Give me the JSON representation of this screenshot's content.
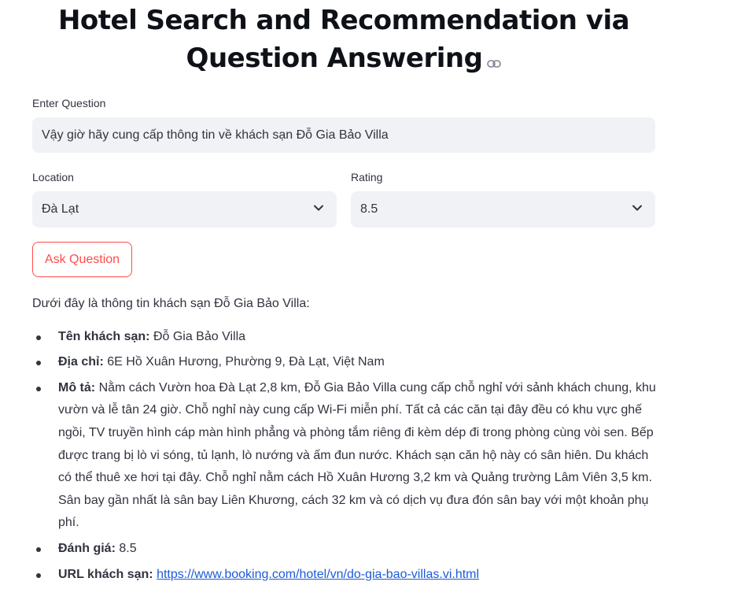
{
  "page": {
    "title_line1": "Hotel Search and Recommendation via",
    "title_line2": "Question Answering",
    "title_icon": "link-icon"
  },
  "question": {
    "label": "Enter Question",
    "value": "Vậy giờ hãy cung cấp thông tin về khách sạn Đỗ Gia Bảo Villa"
  },
  "location": {
    "label": "Location",
    "value": "Đà Lạt",
    "icon": "chevron-down-icon"
  },
  "rating": {
    "label": "Rating",
    "value": "8.5",
    "icon": "chevron-down-icon"
  },
  "ask_button": {
    "label": "Ask Question",
    "color": "#ff4b4b"
  },
  "answer": {
    "intro": "Dưới đây là thông tin khách sạn Đỗ Gia Bảo Villa:",
    "items": [
      {
        "key": "Tên khách sạn:",
        "value": "Đỗ Gia Bảo Villa"
      },
      {
        "key": "Địa chỉ:",
        "value": "6E Hồ Xuân Hương, Phường 9, Đà Lạt, Việt Nam"
      },
      {
        "key": "Mô tả:",
        "value": "Nằm cách Vườn hoa Đà Lạt 2,8 km, Đỗ Gia Bảo Villa cung cấp chỗ nghỉ với sảnh khách chung, khu vườn và lễ tân 24 giờ. Chỗ nghỉ này cung cấp Wi-Fi miễn phí. Tất cả các căn tại đây đều có khu vực ghế ngồi, TV truyền hình cáp màn hình phẳng và phòng tắm riêng đi kèm dép đi trong phòng cùng vòi sen. Bếp được trang bị lò vi sóng, tủ lạnh, lò nướng và ấm đun nước. Khách sạn căn hộ này có sân hiên. Du khách có thể thuê xe hơi tại đây. Chỗ nghỉ nằm cách Hồ Xuân Hương 3,2 km và Quảng trường Lâm Viên 3,5 km. Sân bay gần nhất là sân bay Liên Khương, cách 32 km và có dịch vụ đưa đón sân bay với một khoản phụ phí."
      },
      {
        "key": "Đánh giá:",
        "value": "8.5"
      },
      {
        "key": "URL khách sạn:",
        "value": "https://www.booking.com/hotel/vn/do-gia-bao-villas.vi.html"
      }
    ]
  }
}
